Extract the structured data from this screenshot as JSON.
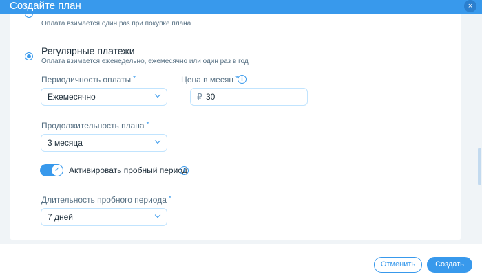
{
  "header": {
    "title": "Создайте план",
    "close_icon": "×"
  },
  "one_time": {
    "description": "Оплата взимается один раз при покупке плана"
  },
  "recurring": {
    "title": "Регулярные платежи",
    "description": "Оплата взимается еженедельно, ежемесячно или один раз в год"
  },
  "fields": {
    "periodicity": {
      "label": "Периодичность оплаты",
      "value": "Ежемесячно"
    },
    "price": {
      "label": "Цена в месяц",
      "currency": "₽",
      "value": "30"
    },
    "duration": {
      "label": "Продолжительность плана",
      "value": "3 месяца"
    },
    "trial_toggle": {
      "label": "Активировать пробный период",
      "on": true
    },
    "trial_duration": {
      "label": "Длительность пробного периода",
      "value": "7 дней"
    }
  },
  "required_mark": "*",
  "info_icon": "i",
  "toggle_icon": "✓",
  "footer": {
    "cancel_label": "Отменить",
    "create_label": "Создать"
  },
  "colors": {
    "accent": "#3899ec",
    "text": "#20303c",
    "secondary_text": "#577083"
  }
}
